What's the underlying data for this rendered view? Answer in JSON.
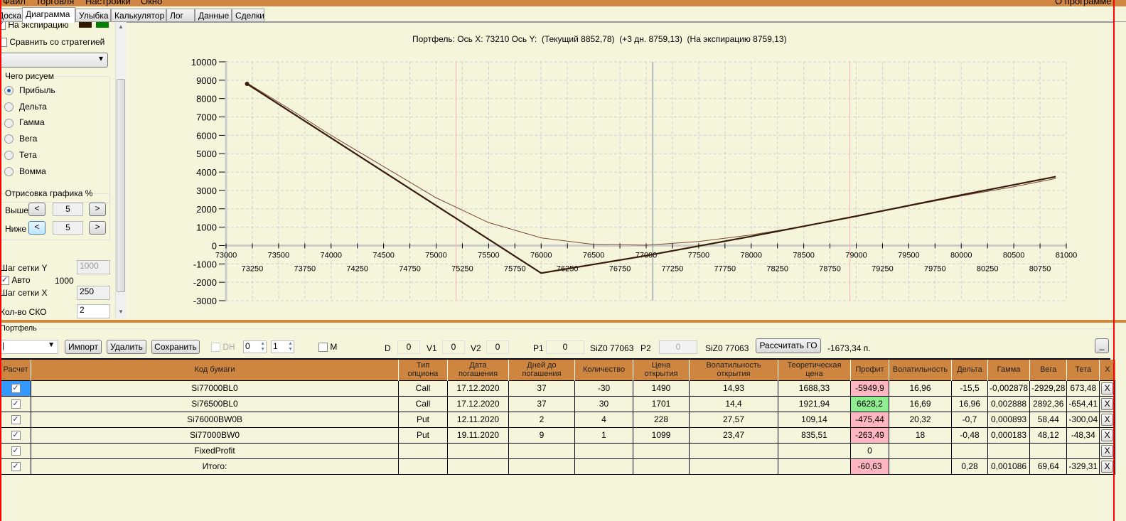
{
  "menu": {
    "items": [
      "Файл",
      "Торговля",
      "Настройки",
      "Окно"
    ],
    "about": "О программе"
  },
  "tabs": [
    "Доска",
    "Диаграмма",
    "Улыбка",
    "Калькулятор",
    "Лог",
    "Данные",
    "Сделки"
  ],
  "left": {
    "expiration_label": "На экспирацию",
    "compare_label": "Сравнить со стратегией",
    "strategy_select": "",
    "draw_group": "Чего рисуем",
    "draw_options": [
      "Прибыль",
      "Дельта",
      "Гамма",
      "Вега",
      "Тета",
      "Вомма"
    ],
    "draw_selected": "Прибыль",
    "range_group": "Отрисовка графика %",
    "above_label": "Выше",
    "above_value": "5",
    "below_label": "Ниже",
    "below_value": "5",
    "prev": "<",
    "next": ">",
    "grid_y_label": "Шаг сетки Y",
    "grid_y_value": "1000",
    "auto_label": "Авто",
    "auto_value": "1000",
    "grid_x_label": "Шаг сетки X",
    "grid_x_value": "250",
    "sko_label": "Кол-во СКО",
    "sko_value": "2",
    "colors": {
      "expiration": "#331a00",
      "current": "#008000"
    }
  },
  "chart_data": {
    "type": "line",
    "title": "Портфель: Ось X: 73210 Ось Y:  (Текущий 8852,78)  (+3 дн. 8759,13)  (На экспирацию 8759,13)",
    "xlim": [
      73000,
      81000
    ],
    "ylim": [
      -3000,
      10000
    ],
    "grid": true,
    "x_ticks_top": [
      73000,
      73500,
      74000,
      74500,
      75000,
      75500,
      76000,
      76500,
      77000,
      77500,
      78000,
      78500,
      79000,
      79500,
      80000,
      80500,
      81000
    ],
    "x_ticks_bottom": [
      73250,
      73750,
      74250,
      74750,
      75250,
      75750,
      76250,
      76750,
      77250,
      77750,
      78250,
      78750,
      79250,
      79750,
      80250,
      80750
    ],
    "y_ticks": [
      10000,
      9000,
      8000,
      7000,
      6000,
      5000,
      4000,
      3000,
      2000,
      1000,
      0,
      -1000,
      -2000,
      -3000
    ],
    "vlines": [
      {
        "x": 75190,
        "color": "#ffb0b0"
      },
      {
        "x": 77063,
        "color": "#708090"
      },
      {
        "x": 78940,
        "color": "#ffb0b0"
      }
    ],
    "series": [
      {
        "color": "#3a1c0c",
        "width": 2.2,
        "points": [
          [
            73200,
            8800
          ],
          [
            76000,
            -1500
          ],
          [
            77000,
            -550
          ],
          [
            78000,
            500
          ],
          [
            79000,
            1600
          ],
          [
            80000,
            2750
          ],
          [
            80900,
            3750
          ]
        ]
      },
      {
        "color": "#7a4a33",
        "width": 1,
        "points": [
          [
            73200,
            8850
          ],
          [
            73600,
            7450
          ],
          [
            74000,
            6000
          ],
          [
            74500,
            4300
          ],
          [
            75000,
            2600
          ],
          [
            75500,
            1250
          ],
          [
            76000,
            420
          ],
          [
            76500,
            60
          ],
          [
            77000,
            20
          ],
          [
            77500,
            220
          ],
          [
            78000,
            580
          ],
          [
            78500,
            1050
          ],
          [
            79000,
            1600
          ],
          [
            79500,
            2150
          ],
          [
            80000,
            2700
          ],
          [
            80500,
            3200
          ],
          [
            80900,
            3650
          ]
        ]
      }
    ]
  },
  "portfolio": {
    "title": "Портфель",
    "select": "",
    "import": "Импорт",
    "delete": "Удалить",
    "save": "Сохранить",
    "dh": "DH",
    "spin1": "0",
    "spin2": "1",
    "m": "M",
    "d_label": "D",
    "d": "0",
    "v1_label": "V1",
    "v1": "0",
    "v2_label": "V2",
    "v2": "0",
    "p1_label": "P1",
    "p1": "0",
    "p1_inst": "SiZ0 77063",
    "p2_label": "P2",
    "p2": "0",
    "p2_inst": "SiZ0 77063",
    "calc": "Рассчитать ГО",
    "go": "-1673,34 п.",
    "minimize": "_",
    "columns": [
      "Расчет",
      "Код бумаги",
      "Тип опциона",
      "Дата погашения",
      "Дней до погашения",
      "Количество",
      "Цена открытия",
      "Волатильность открытия",
      "Теоретическая цена",
      "Профит",
      "Волатильность",
      "Дельта",
      "Гамма",
      "Вега",
      "Тета",
      "X"
    ],
    "rows": [
      {
        "code": "Si77000BL0",
        "type": "Call",
        "date": "17.12.2020",
        "days": "37",
        "qty": "-30",
        "price": "1490",
        "vol_open": "14,93",
        "theor": "1688,33",
        "profit": "-5949,9",
        "vol": "16,96",
        "delta": "-15,5",
        "gamma": "-0,002878",
        "vega": "-2929,28",
        "theta": "673,48",
        "ps": "neg"
      },
      {
        "code": "Si76500BL0",
        "type": "Call",
        "date": "17.12.2020",
        "days": "37",
        "qty": "30",
        "price": "1701",
        "vol_open": "14,4",
        "theor": "1921,94",
        "profit": "6628,2",
        "vol": "16,69",
        "delta": "16,96",
        "gamma": "0,002888",
        "vega": "2892,36",
        "theta": "-654,41",
        "ps": "pos"
      },
      {
        "code": "Si76000BW0B",
        "type": "Put",
        "date": "12.11.2020",
        "days": "2",
        "qty": "4",
        "price": "228",
        "vol_open": "27,57",
        "theor": "109,14",
        "profit": "-475,44",
        "vol": "20,32",
        "delta": "-0,7",
        "gamma": "0,000893",
        "vega": "58,44",
        "theta": "-300,04",
        "ps": "neg"
      },
      {
        "code": "Si77000BW0",
        "type": "Put",
        "date": "19.11.2020",
        "days": "9",
        "qty": "1",
        "price": "1099",
        "vol_open": "23,47",
        "theor": "835,51",
        "profit": "-263,49",
        "vol": "18",
        "delta": "-0,48",
        "gamma": "0,000183",
        "vega": "48,12",
        "theta": "-48,34",
        "ps": "neg"
      },
      {
        "code": "FixedProfit",
        "type": "",
        "date": "",
        "days": "",
        "qty": "",
        "price": "",
        "vol_open": "",
        "theor": "",
        "profit": "0",
        "vol": "",
        "delta": "",
        "gamma": "",
        "vega": "",
        "theta": "",
        "ps": ""
      },
      {
        "code": "Итого:",
        "type": "",
        "date": "",
        "days": "",
        "qty": "",
        "price": "",
        "vol_open": "",
        "theor": "",
        "profit": "-60,63",
        "vol": "",
        "delta": "0,28",
        "gamma": "0,001086",
        "vega": "69,64",
        "theta": "-329,31",
        "ps": "neg"
      }
    ],
    "remove": "X"
  }
}
